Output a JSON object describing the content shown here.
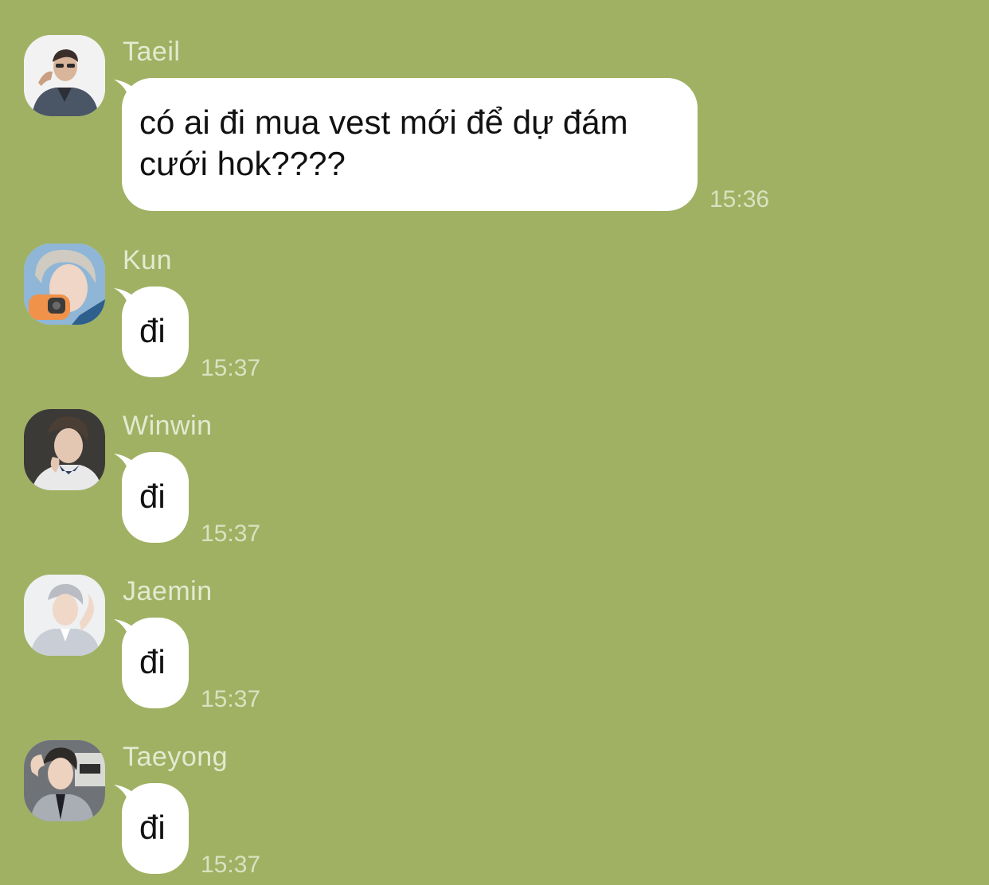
{
  "messages": [
    {
      "sender": "Taeil",
      "text": "có ai đi mua vest mới để dự đám cưới hok????",
      "time": "15:36",
      "avatar_icon": "avatar-photo-taeil"
    },
    {
      "sender": "Kun",
      "text": "đi",
      "time": "15:37",
      "avatar_icon": "avatar-photo-kun"
    },
    {
      "sender": "Winwin",
      "text": "đi",
      "time": "15:37",
      "avatar_icon": "avatar-photo-winwin"
    },
    {
      "sender": "Jaemin",
      "text": "đi",
      "time": "15:37",
      "avatar_icon": "avatar-photo-jaemin"
    },
    {
      "sender": "Taeyong",
      "text": "đi",
      "time": "15:37",
      "avatar_icon": "avatar-photo-taeyong"
    }
  ],
  "colors": {
    "background": "#a0b163",
    "bubble": "#ffffff",
    "name_text": "#e3ead0",
    "time_text": "#d9e2c1"
  }
}
